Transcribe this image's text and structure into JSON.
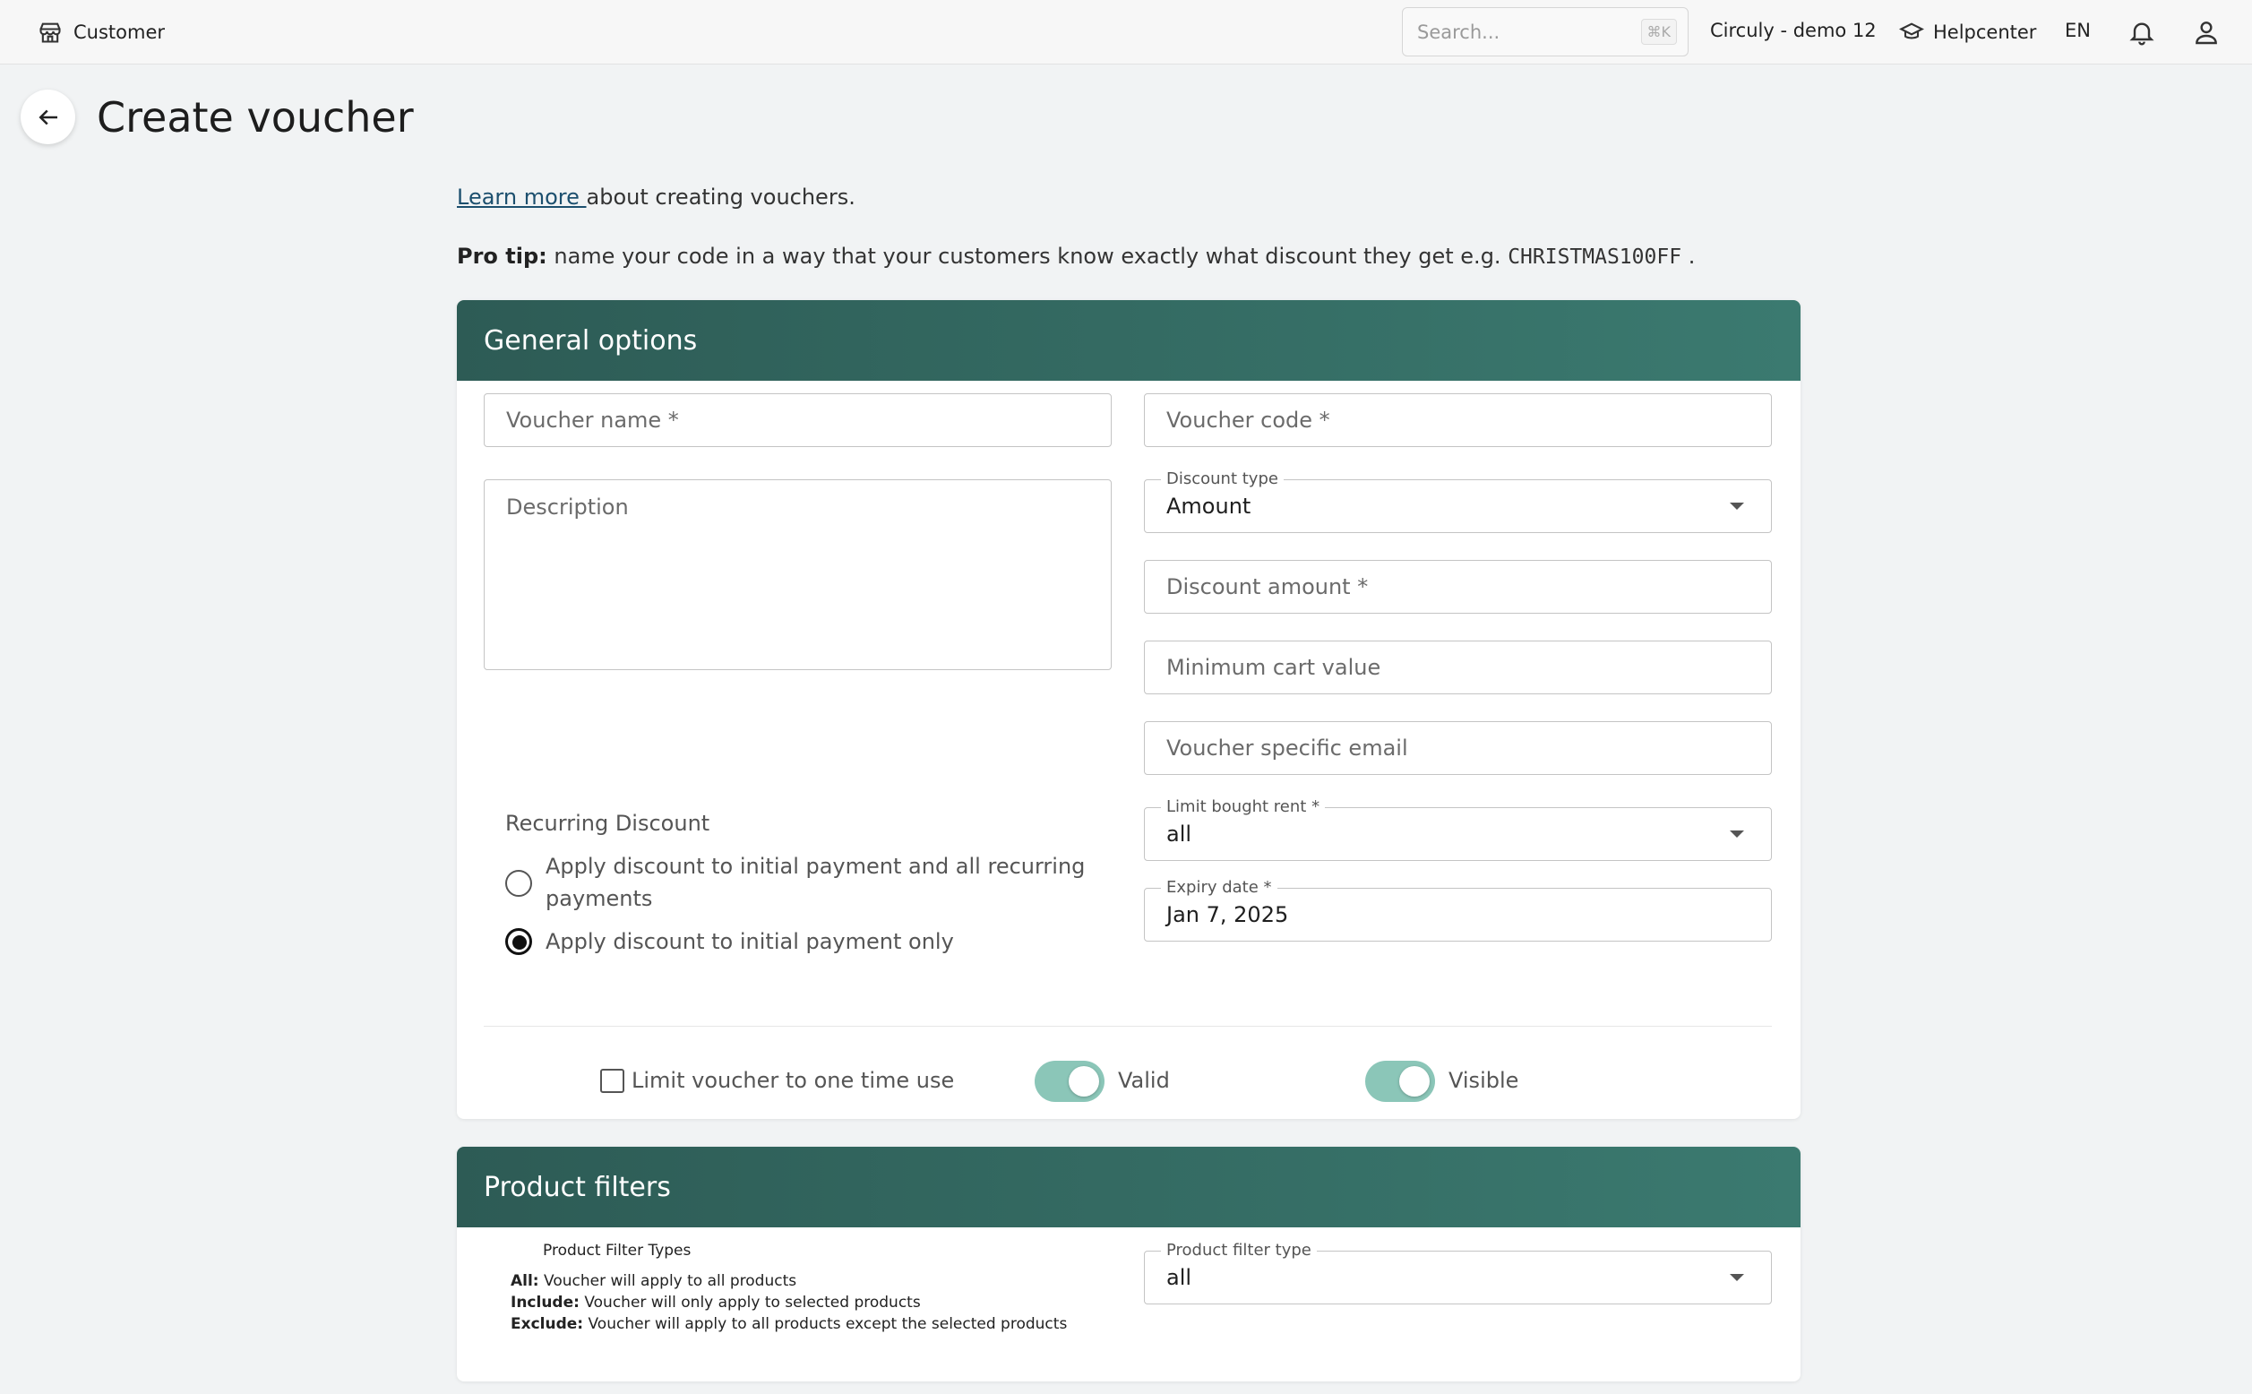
{
  "topbar": {
    "brand_label": "Customer",
    "search_placeholder": "Search...",
    "search_shortcut": "⌘K",
    "shop_name": "Circuly - demo 12",
    "help_label": "Helpcenter",
    "language": "EN"
  },
  "page": {
    "title": "Create voucher",
    "learn_link": "Learn more ",
    "learn_rest": "about creating vouchers.",
    "protip_label": "Pro tip:",
    "protip_text": " name your code in a way that your customers know exactly what discount they get e.g. ",
    "protip_code": "CHRISTMAS100FF",
    "protip_end": " ."
  },
  "general": {
    "title": "General options",
    "voucher_name_placeholder": "Voucher name *",
    "voucher_code_placeholder": "Voucher code *",
    "description_placeholder": "Description",
    "discount_type_label": "Discount type",
    "discount_type_value": "Amount",
    "discount_amount_placeholder": "Discount amount *",
    "min_cart_placeholder": "Minimum cart value",
    "specific_email_placeholder": "Voucher specific email",
    "limit_rent_label": "Limit bought rent *",
    "limit_rent_value": "all",
    "expiry_label": "Expiry date *",
    "expiry_value": "Jan 7, 2025",
    "recurring_label": "Recurring Discount",
    "recurring_opt1_line1": "Apply discount to initial payment and all recurring",
    "recurring_opt1_line2": "payments",
    "recurring_opt2": "Apply discount to initial payment only",
    "one_time_label": "Limit voucher to one time use",
    "valid_label": "Valid",
    "visible_label": "Visible"
  },
  "product_filters": {
    "title": "Product filters",
    "help_title": "Product Filter Types",
    "all_key": "All:",
    "all_text": " Voucher will apply to all products",
    "include_key": "Include:",
    "include_text": " Voucher will only apply to selected products",
    "exclude_key": "Exclude:",
    "exclude_text": " Voucher will apply to all products except the selected products",
    "filter_type_label": "Product filter type",
    "filter_type_value": "all"
  },
  "colors": {
    "header_gradient_start": "#2d5b55",
    "header_gradient_end": "#3b7a70",
    "toggle_on": "#8bc6b8",
    "link": "#1c4f6e"
  }
}
